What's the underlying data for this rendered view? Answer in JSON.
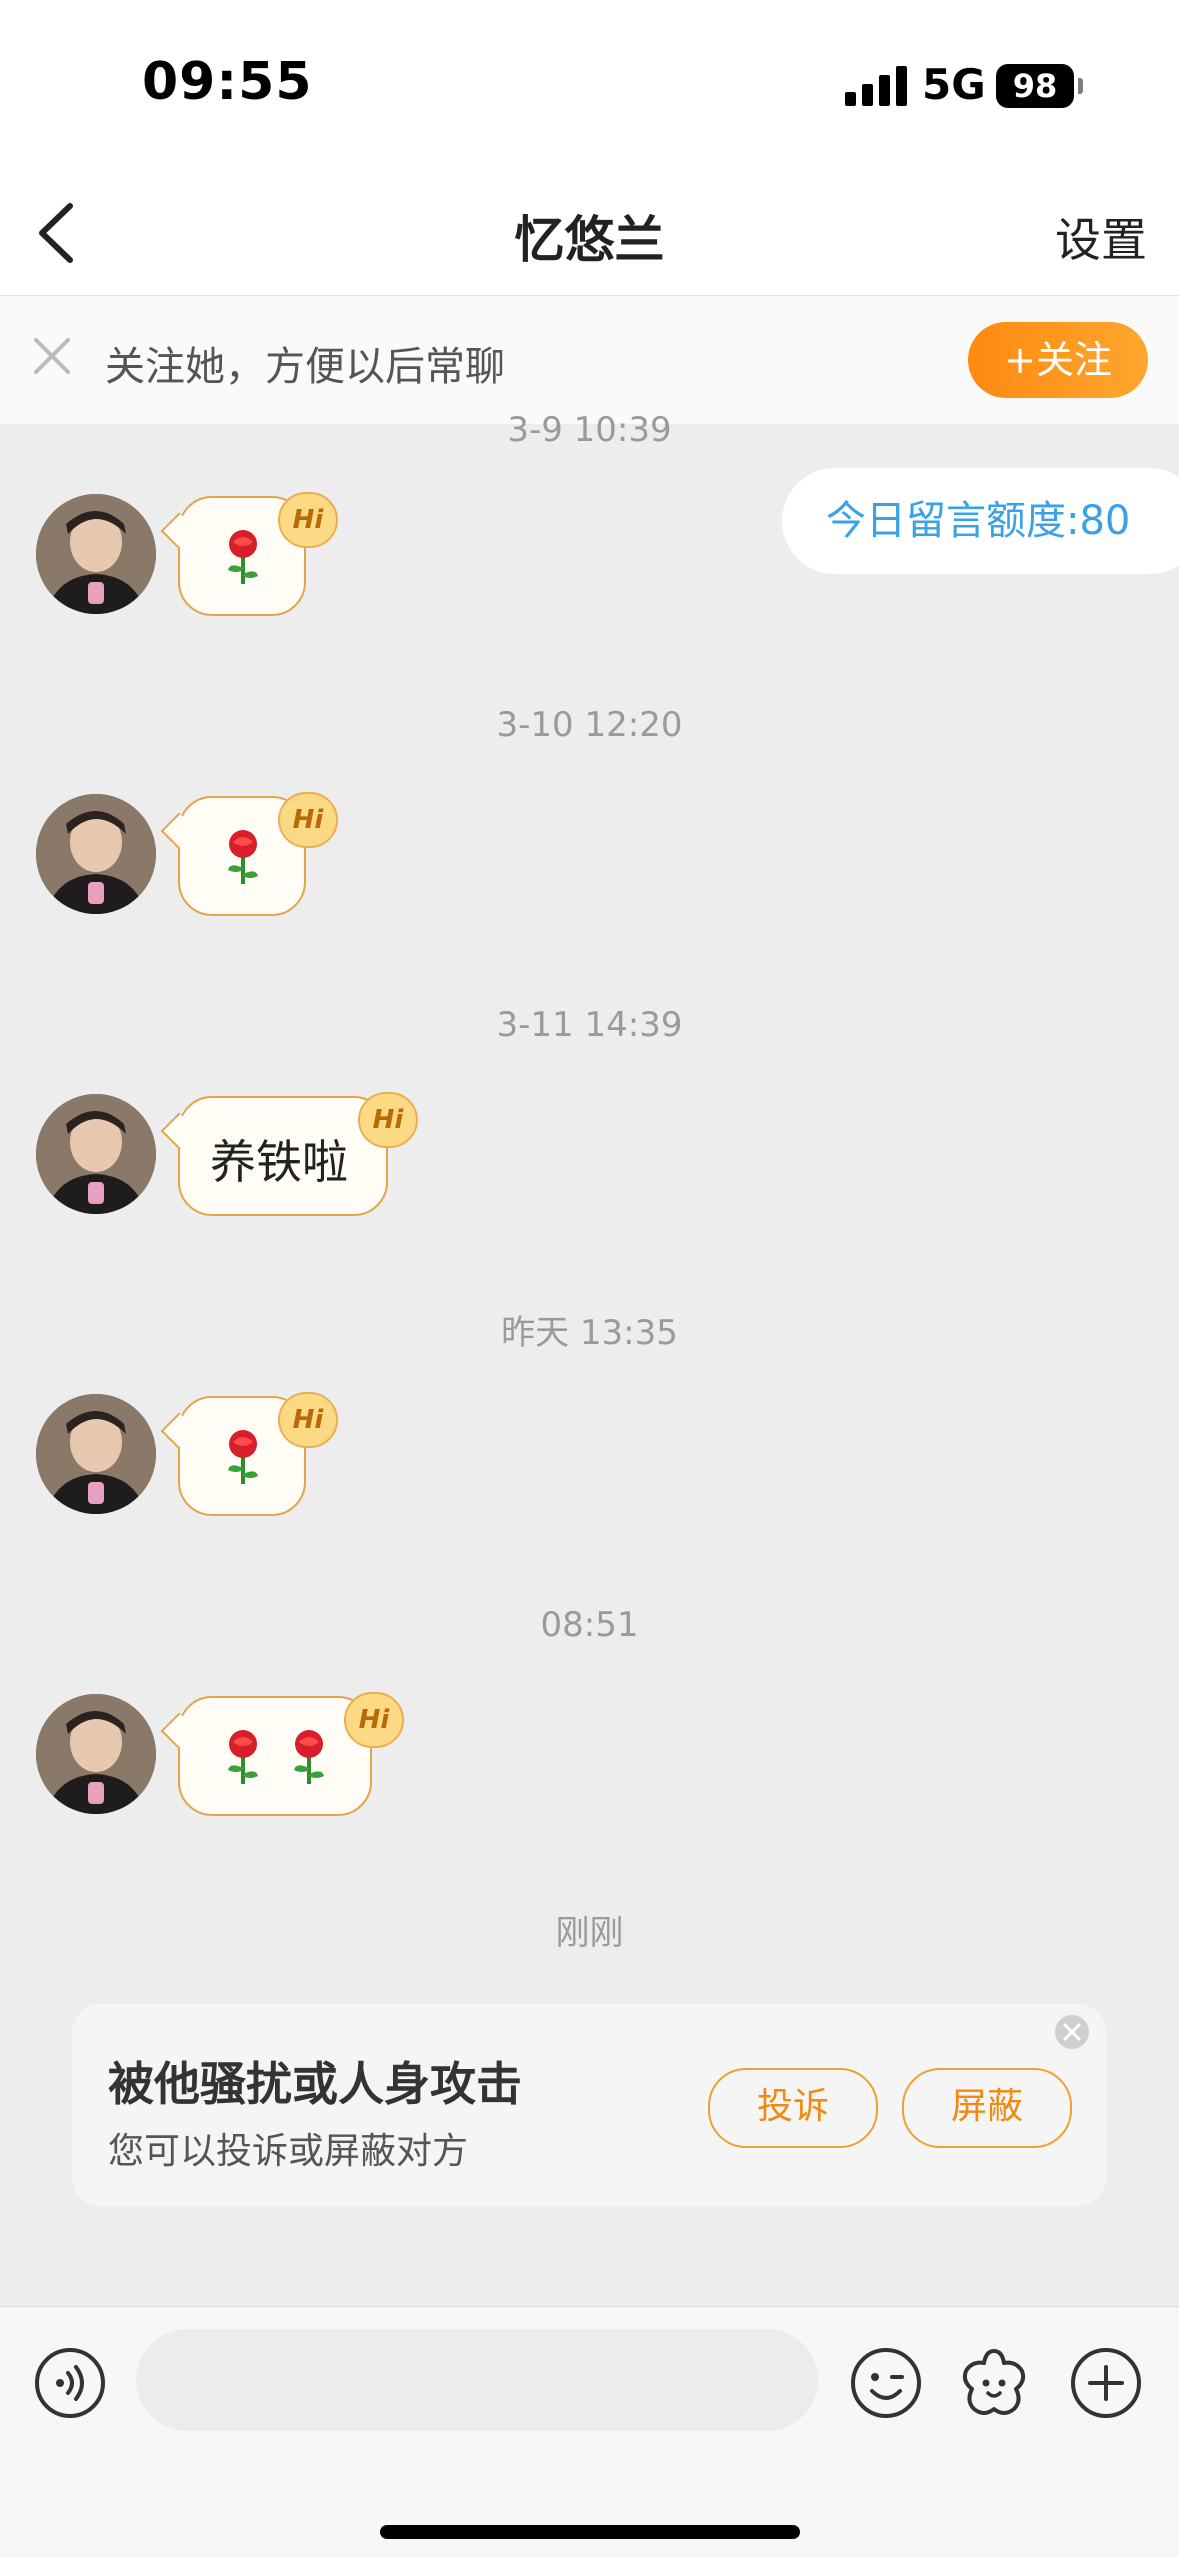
{
  "status_bar": {
    "time": "09:55",
    "network": "5G",
    "battery": "98"
  },
  "nav": {
    "title": "忆悠兰",
    "settings_label": "设置"
  },
  "follow_banner": {
    "text": "关注她，方便以后常聊",
    "button_label": "+关注"
  },
  "quota": {
    "text": "今日留言额度:80"
  },
  "messages": [
    {
      "timestamp": "3-9 10:39",
      "content": "rose",
      "text": ""
    },
    {
      "timestamp": "3-10 12:20",
      "content": "rose",
      "text": ""
    },
    {
      "timestamp": "3-11 14:39",
      "content": "text",
      "text": "养铁啦"
    },
    {
      "timestamp": "昨天 13:35",
      "content": "rose",
      "text": ""
    },
    {
      "timestamp": "08:51",
      "content": "rose-rose",
      "text": ""
    }
  ],
  "hi_badge": "Hi",
  "latest_timestamp": "刚刚",
  "harass_card": {
    "title": "被他骚扰或人身攻击",
    "subtitle": "您可以投诉或屏蔽对方",
    "report_label": "投诉",
    "block_label": "屏蔽"
  },
  "input": {
    "value": "",
    "placeholder": ""
  },
  "icons": [
    "voice-icon",
    "emoji-icon",
    "sticker-icon",
    "plus-icon",
    "back-chevron-icon",
    "close-icon",
    "rose-emoji-icon"
  ],
  "colors": {
    "accent_orange": "#ff9a1f",
    "quota_blue": "#3aa0e8",
    "bubble_border": "#e0a54a",
    "background": "#ededed"
  }
}
